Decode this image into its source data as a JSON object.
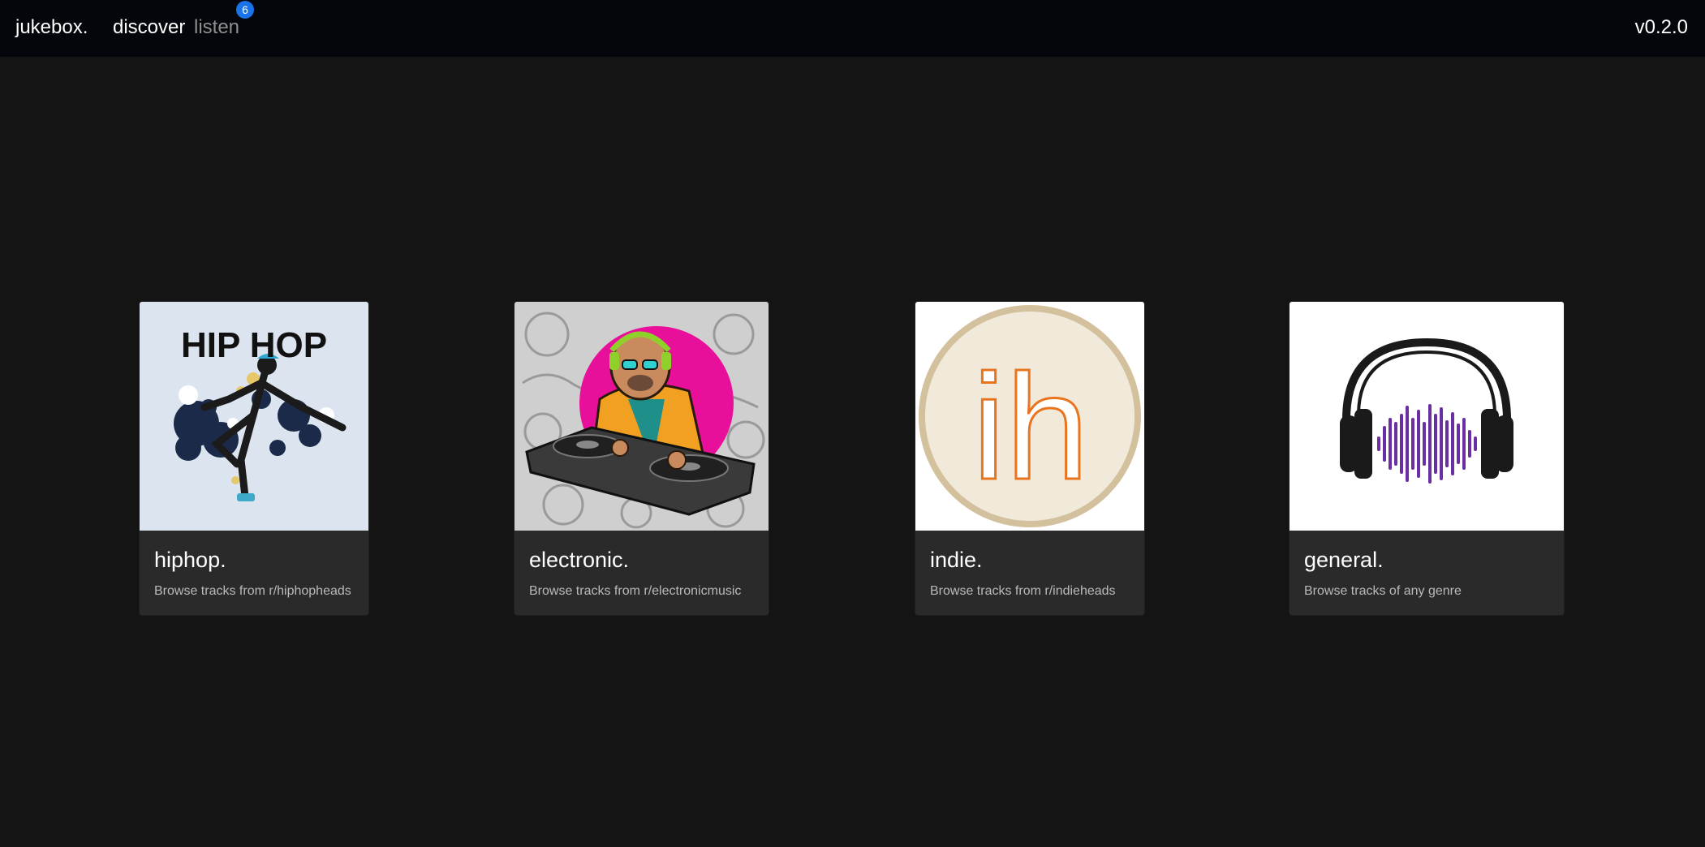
{
  "app": {
    "brand": "jukebox.",
    "version": "v0.2.0"
  },
  "nav": {
    "discover": "discover",
    "listen": "listen",
    "listen_badge": "6"
  },
  "colors": {
    "navbar_bg": "#03060b",
    "page_bg": "#141414",
    "card_bg": "#2a2a2a",
    "badge": "#1a73e8"
  },
  "genres": [
    {
      "title": "hiphop.",
      "description": "Browse tracks from r/hiphopheads",
      "image_text": "HIP HOP",
      "icon": "breakdancer-illustration"
    },
    {
      "title": "electronic.",
      "description": "Browse tracks from r/electronicmusic",
      "icon": "dj-turntables-illustration"
    },
    {
      "title": "indie.",
      "description": "Browse tracks from r/indieheads",
      "image_text": "ih",
      "icon": "indieheads-logo"
    },
    {
      "title": "general.",
      "description": "Browse tracks of any genre",
      "icon": "headphones-soundwave-icon"
    }
  ]
}
